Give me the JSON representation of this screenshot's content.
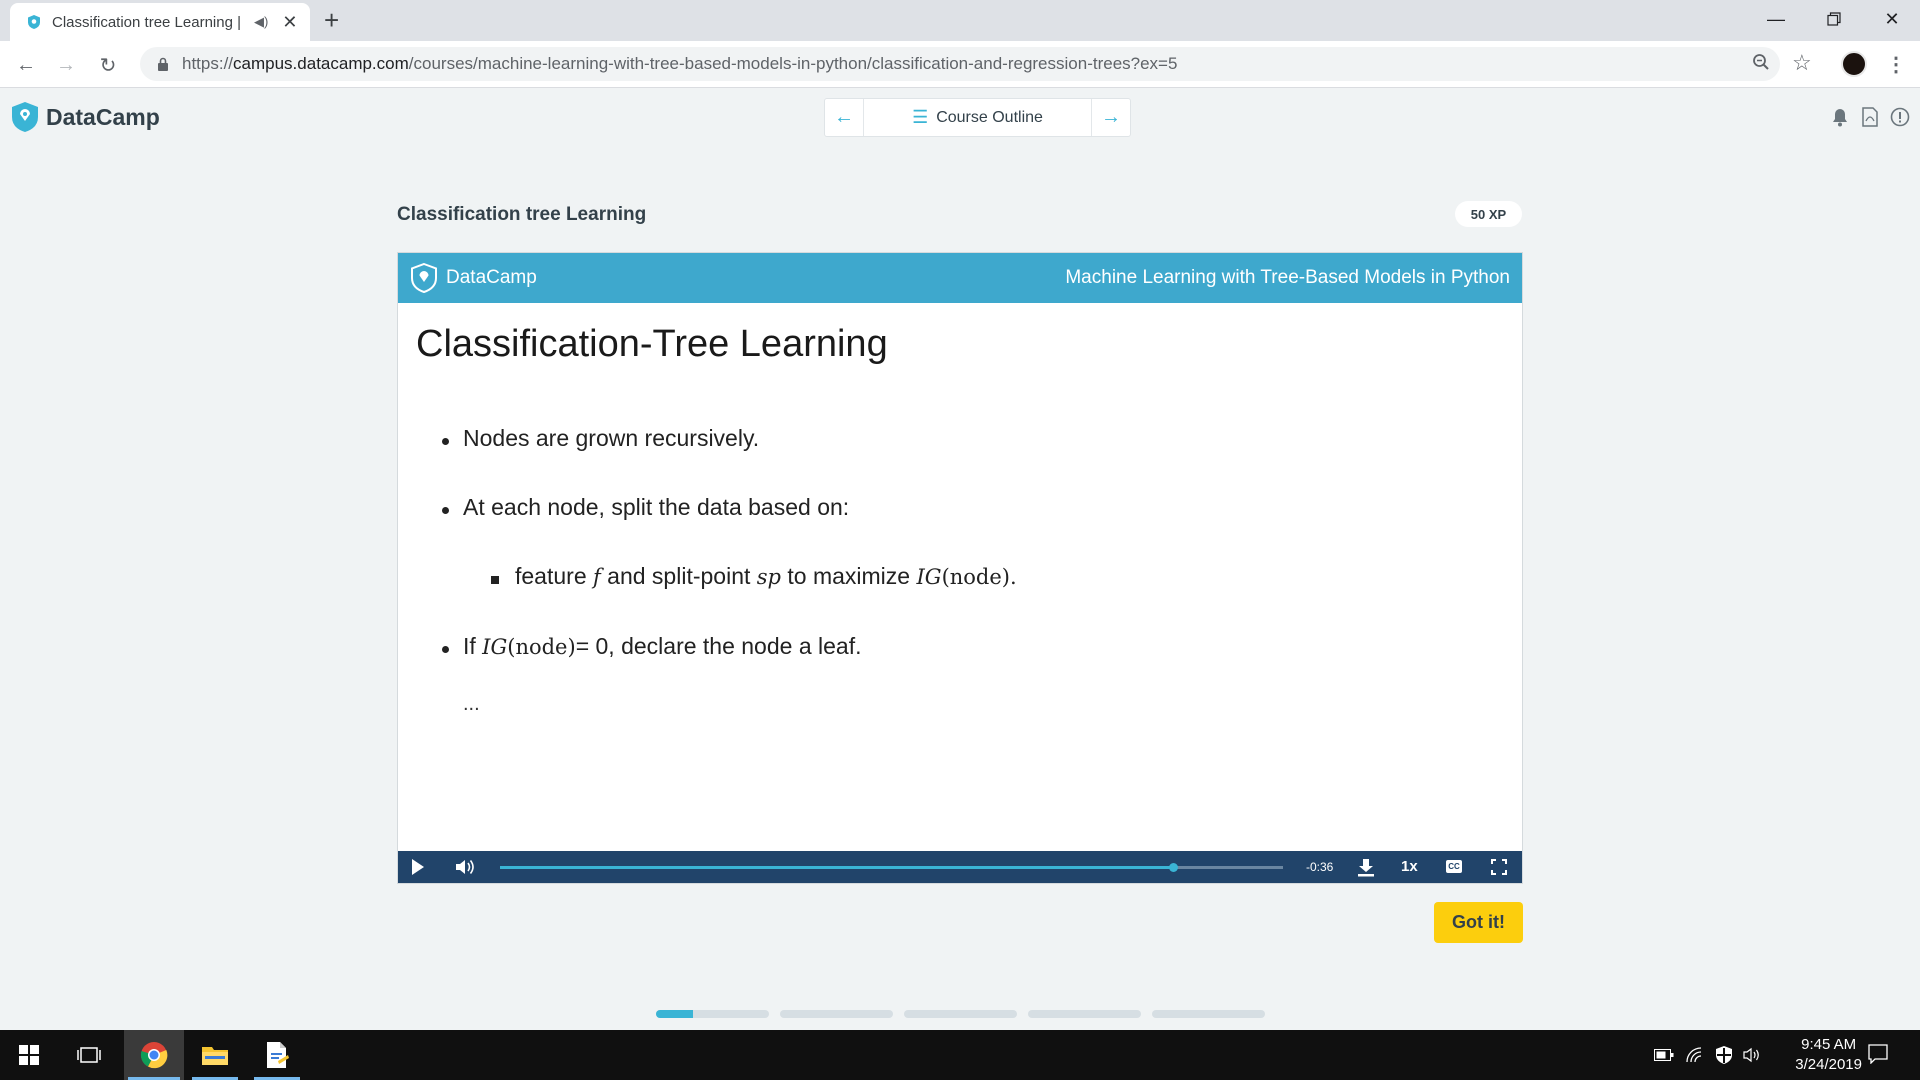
{
  "browser": {
    "tab_title": "Classification tree Learning |",
    "url_scheme": "https://",
    "url_host": "campus.datacamp.com",
    "url_path": "/courses/machine-learning-with-tree-based-models-in-python/classification-and-regression-trees?ex=5",
    "new_tab_label": "+"
  },
  "header": {
    "logo_text": "DataCamp",
    "course_outline_label": "Course Outline"
  },
  "exercise": {
    "title": "Classification tree Learning",
    "xp_badge": "50 XP",
    "got_it_label": "Got it!"
  },
  "video": {
    "brand": "DataCamp",
    "course_name": "Machine Learning with Tree-Based Models in Python",
    "slide_title": "Classification-Tree Learning",
    "bullet1": "Nodes are grown recursively.",
    "bullet2": "At each node, split the data based on:",
    "sub_feature": "feature",
    "sub_f": "f",
    "sub_and": "and split-point",
    "sub_sp": "sp",
    "sub_to": "to maximize",
    "sub_ig": "IG",
    "sub_node": "(node).",
    "bullet3_if": "If",
    "bullet3_ig": "IG",
    "bullet3_node": "(node)",
    "bullet3_rest": "= 0, declare the node a leaf.",
    "ellipsis": "...",
    "time_remaining": "-0:36",
    "speed": "1x",
    "cc_label": "CC",
    "progress_fraction": 0.86
  },
  "lesson_progress": [
    0.33,
    0,
    0,
    0,
    0
  ],
  "taskbar": {
    "time": "9:45 AM",
    "date": "3/24/2019"
  },
  "colors": {
    "accent": "#3ab4d5",
    "video_header": "#3ea8cd",
    "video_controls": "#21446a",
    "got_it": "#fcce0d",
    "page_bg": "#f0f3f4"
  }
}
